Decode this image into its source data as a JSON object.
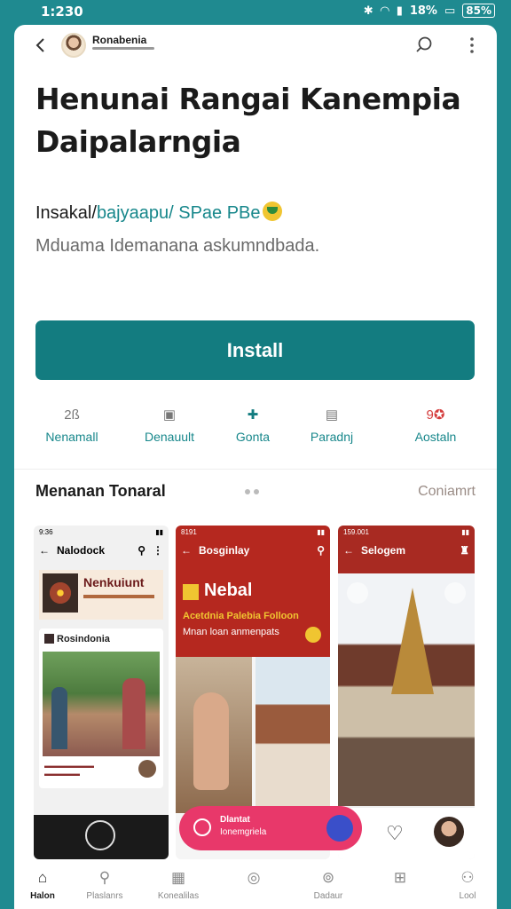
{
  "status_bar": {
    "time": "1:230",
    "signal_text": "18%",
    "battery": "85%"
  },
  "app_bar": {
    "developer_name": "Ronabenia"
  },
  "app": {
    "title": "Henunai Rangai Kanempia Daipalarngia",
    "publisher_prefix": "Insakal/",
    "publisher_link": "bajyaapu/ SPae PBe",
    "tagline": "Mduama Idemanana askumndbada."
  },
  "install_label": "Install",
  "stats": [
    {
      "icon": "2ß",
      "label": "Nenamall"
    },
    {
      "icon": "▣",
      "label": "Denauult"
    },
    {
      "icon": "✚",
      "label": "Gonta"
    },
    {
      "icon": "▤",
      "label": "Paradnj"
    },
    {
      "icon": "9✪",
      "label": "Aostaln"
    }
  ],
  "section": {
    "title": "Menanan Tonaral",
    "action": "Coniamrt"
  },
  "screenshots": {
    "s1": {
      "time": "9:36",
      "bar_title": "Nalodock",
      "banner_title": "Nenkuiunt",
      "card_title": "Rosindonia"
    },
    "s2": {
      "time": "8191",
      "bar_title": "Bosginlay",
      "big_title": "Nebal",
      "sub1": "Acetdnia Palebia Folloon",
      "sub2": "Mnan loan anmenpats",
      "chip_t1": "Dlantat",
      "chip_t2": "Ionemgriela"
    },
    "s3": {
      "time": "159.001",
      "bar_title": "Selogem"
    }
  },
  "bottom_nav": [
    {
      "icon": "⌂",
      "label": "Halon",
      "active": true
    },
    {
      "icon": "⚲",
      "label": "Plaslanrs"
    },
    {
      "icon": "▦",
      "label": "Konealilas"
    },
    {
      "icon": "◎",
      "label": ""
    },
    {
      "icon": "⊚",
      "label": "Dadaur"
    },
    {
      "icon": "⊞",
      "label": ""
    },
    {
      "icon": "⚇",
      "label": "Lool"
    }
  ],
  "colors": {
    "accent": "#137c80",
    "link": "#17878b",
    "status_bg": "#1f8a90"
  }
}
